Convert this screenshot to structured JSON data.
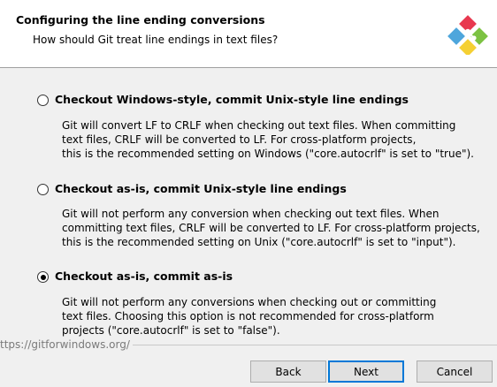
{
  "header": {
    "title": "Configuring the line ending conversions",
    "subtitle": "How should Git treat line endings in text files?"
  },
  "options": [
    {
      "label": "Checkout Windows-style, commit Unix-style line endings",
      "selected": false,
      "description": [
        "Git will convert LF to CRLF when checking out text files. When committing",
        "text files, CRLF will be converted to LF. For cross-platform projects,",
        "this is the recommended setting on Windows (\"core.autocrlf\" is set to \"true\")."
      ]
    },
    {
      "label": "Checkout as-is, commit Unix-style line endings",
      "selected": false,
      "description": [
        "Git will not perform any conversion when checking out text files. When",
        "committing text files, CRLF will be converted to LF. For cross-platform projects,",
        "this is the recommended setting on Unix (\"core.autocrlf\" is set to \"input\")."
      ]
    },
    {
      "label": "Checkout as-is, commit as-is",
      "selected": true,
      "description": [
        "Git will not perform any conversions when checking out or committing",
        "text files. Choosing this option is not recommended for cross-platform",
        "projects (\"core.autocrlf\" is set to \"false\")."
      ]
    }
  ],
  "footer": {
    "url": "ttps://gitforwindows.org/"
  },
  "buttons": {
    "back": "Back",
    "next": "Next",
    "cancel": "Cancel"
  },
  "colors": {
    "logo_red": "#e8384f",
    "logo_green": "#7cc242",
    "logo_blue": "#4ea6dc",
    "logo_yellow": "#f5d033",
    "default_button_border": "#0078d7"
  },
  "icons": {
    "logo": "git-for-windows-logo-icon"
  }
}
